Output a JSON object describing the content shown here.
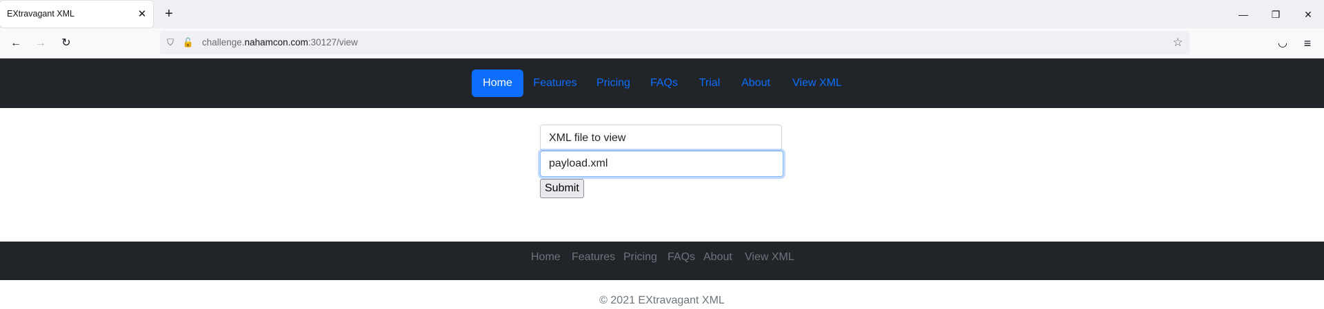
{
  "browser": {
    "tab_title": "EXtravagant XML",
    "close_glyph": "✕",
    "new_tab_glyph": "+",
    "window_controls": {
      "minimize": "—",
      "restore": "❐",
      "close": "✕"
    },
    "url_prefix": "challenge.",
    "url_host": "nahamcon.com",
    "url_suffix": ":30127/view",
    "icons": {
      "back": "←",
      "forward": "→",
      "reload": "↻",
      "shield": "⛉",
      "lock": "🔓",
      "star": "☆",
      "pocket": "◡",
      "menu": "≡"
    }
  },
  "nav": {
    "items": [
      {
        "label": "Home",
        "active": true
      },
      {
        "label": "Features"
      },
      {
        "label": "Pricing"
      },
      {
        "label": "FAQs"
      },
      {
        "label": "Trial"
      },
      {
        "label": "About"
      },
      {
        "label": "View XML"
      }
    ]
  },
  "form": {
    "label_text": "XML file to view",
    "input_value": "payload.xml",
    "submit_label": "Submit"
  },
  "footer": {
    "links": [
      "Home",
      "Features",
      "Pricing",
      "FAQs",
      "About",
      "View XML"
    ],
    "copyright": "© 2021 EXtravagant XML"
  },
  "colors": {
    "nav_bg": "#212529",
    "accent": "#0d6efd",
    "footer_text": "#6c757d"
  }
}
